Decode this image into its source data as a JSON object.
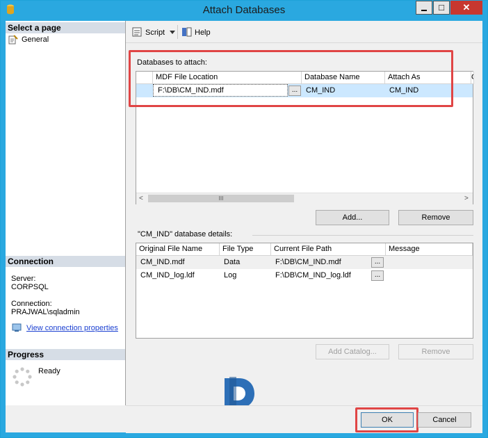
{
  "window": {
    "title": "Attach Databases",
    "minimize": "",
    "maximize": "□",
    "close": "✕"
  },
  "left": {
    "select_page_header": "Select a page",
    "pages": [
      {
        "label": "General"
      }
    ],
    "connection_header": "Connection",
    "server_label": "Server:",
    "server_value": "CORPSQL",
    "connection_label": "Connection:",
    "connection_value": "PRAJWAL\\sqladmin",
    "view_connection_link": "View connection properties",
    "progress_header": "Progress",
    "progress_status": "Ready"
  },
  "toolbar": {
    "script_label": "Script",
    "help_label": "Help"
  },
  "attach": {
    "section_label": "Databases to attach:",
    "columns": [
      "MDF File Location",
      "Database Name",
      "Attach As",
      "O"
    ],
    "rows": [
      {
        "mdf": "F:\\DB\\CM_IND.mdf",
        "db_name": "CM_IND",
        "attach_as": "CM_IND"
      }
    ],
    "add_button": "Add...",
    "remove_button": "Remove"
  },
  "details": {
    "section_label": "\"CM_IND\" database details:",
    "columns": [
      "Original File Name",
      "File Type",
      "Current File Path",
      "Message"
    ],
    "rows": [
      {
        "name": "CM_IND.mdf",
        "type": "Data",
        "path": "F:\\DB\\CM_IND.mdf",
        "message": ""
      },
      {
        "name": "CM_IND_log.ldf",
        "type": "Log",
        "path": "F:\\DB\\CM_IND_log.ldf",
        "message": ""
      }
    ],
    "add_catalog_button": "Add Catalog...",
    "remove_button": "Remove"
  },
  "footer": {
    "ok": "OK",
    "cancel": "Cancel"
  },
  "ellipsis": "...",
  "scroll_thumb": "III",
  "colors": {
    "title_bar": "#2aa8e0",
    "selected_row": "#cce8ff",
    "highlight_box": "#e04545",
    "link": "#1a3fd1",
    "watermark": "#2d6fb7"
  }
}
